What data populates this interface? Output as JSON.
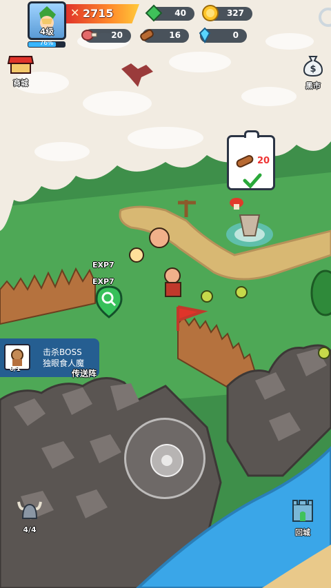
{
  "player": {
    "level": "4级",
    "xp_percent": "76%",
    "xp_fraction": 0.76
  },
  "power": {
    "value": "2715",
    "icon": "crossed-swords-icon"
  },
  "resources": {
    "gem": {
      "value": "40",
      "icon": "green-gem-icon"
    },
    "coin": {
      "value": "327",
      "icon": "gold-coin-icon"
    },
    "meat": {
      "value": "20",
      "icon": "meat-icon"
    },
    "wood": {
      "value": "16",
      "icon": "wood-log-icon"
    },
    "crystal": {
      "value": "0",
      "icon": "blue-crystal-icon"
    }
  },
  "buttons": {
    "shop": {
      "label": "商城",
      "icon": "shop-stall-icon"
    },
    "black_market": {
      "label": "黑市",
      "icon": "money-bag-icon"
    },
    "troops": {
      "label": "4/4",
      "icon": "viking-helmet-icon"
    },
    "return_city": {
      "label": "回城",
      "icon": "castle-icon"
    }
  },
  "quest_card": {
    "count": "20",
    "icon": "wood-log-icon",
    "check_icon": "check-icon"
  },
  "task": {
    "line1": "击杀BOSS",
    "line2": "独眼食人魔",
    "progress": "0/1",
    "icon": "ogre-boss-icon"
  },
  "floating_labels": {
    "exp1": "EXP7",
    "exp2": "EXP7",
    "portal": "传送阵"
  },
  "colors": {
    "grass": "#3e8f4a",
    "fog": "#f2ece2",
    "water": "#3aa6e8",
    "accent_red": "#e0342a",
    "panel_blue": "#1e529b"
  }
}
